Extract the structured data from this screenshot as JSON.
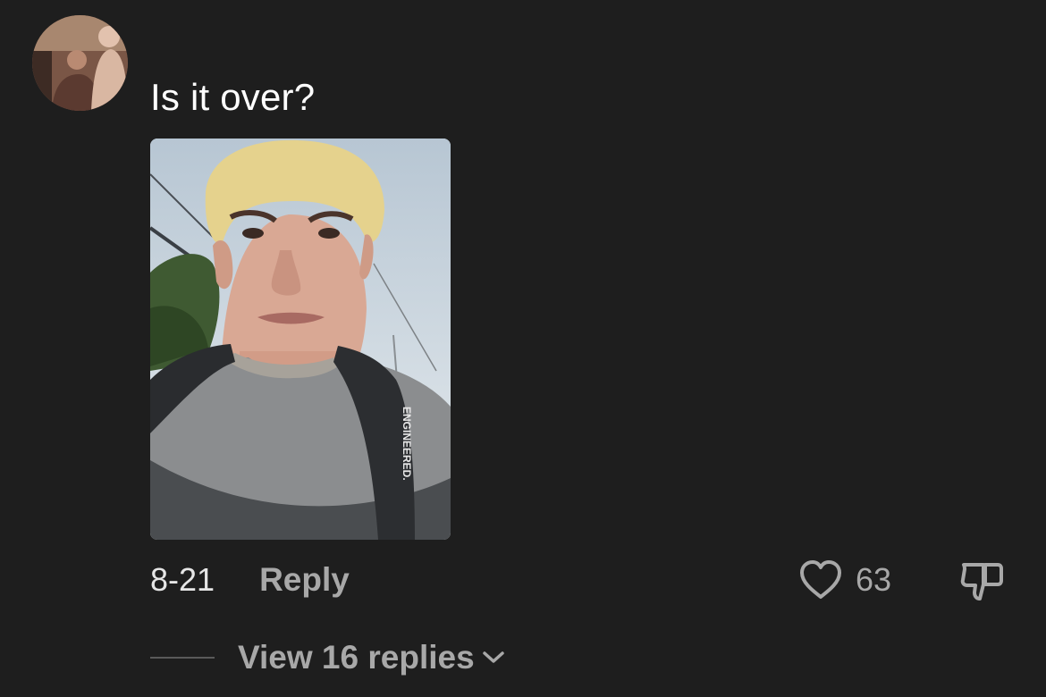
{
  "comment": {
    "text": "Is it over?",
    "date": "8-21",
    "reply_label": "Reply",
    "like_count": "63",
    "view_replies_label": "View 16 replies"
  },
  "icons": {
    "avatar": "user-avatar",
    "like": "heart-outline-icon",
    "dislike": "thumbs-down-icon",
    "expand": "chevron-down-icon"
  },
  "colors": {
    "background": "#1e1e1e",
    "primary_text": "#ffffff",
    "secondary_text": "#a8a8a8"
  }
}
